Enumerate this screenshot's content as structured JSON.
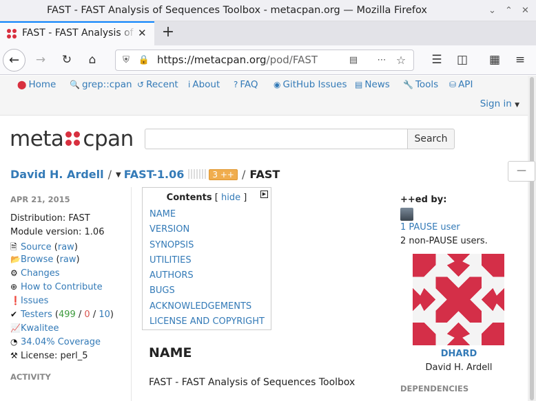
{
  "browser": {
    "window_title": "FAST - FAST Analysis of Sequences Toolbox - metacpan.org — Mozilla Firefox",
    "tab_title": "FAST - FAST Analysis of Sequences Toolbox",
    "url_host": "https://metacpan.org",
    "url_path": "/pod/FAST"
  },
  "sitenav": {
    "items": [
      {
        "label": "Home",
        "icon": "home-dots-icon"
      },
      {
        "label": "grep::cpan",
        "icon": "search-icon"
      },
      {
        "label": "Recent",
        "icon": "history-icon"
      },
      {
        "label": "About",
        "icon": "info-icon"
      },
      {
        "label": "FAQ",
        "icon": "question-icon"
      },
      {
        "label": "GitHub Issues",
        "icon": "github-icon"
      },
      {
        "label": "News",
        "icon": "news-icon"
      },
      {
        "label": "Tools",
        "icon": "wrench-icon"
      },
      {
        "label": "API",
        "icon": "database-icon"
      }
    ],
    "signin": "Sign in"
  },
  "logo": {
    "left": "meta",
    "right": "cpan"
  },
  "search": {
    "button": "Search",
    "placeholder": ""
  },
  "breadcrumb": {
    "author": "David H. Ardell",
    "release": "FAST-1.06",
    "plusplus": "3 ++",
    "module": "FAST"
  },
  "release_info": {
    "date": "APR 21, 2015",
    "distribution": "Distribution: FAST",
    "module_version": "Module version: 1.06",
    "source": "Source",
    "source_raw": "raw",
    "browse": "Browse",
    "browse_raw": "raw",
    "changes": "Changes",
    "contribute": "How to Contribute",
    "issues": "Issues",
    "testers": "Testers",
    "testers_pass": "499",
    "testers_fail": "0",
    "testers_na": "10",
    "kwalitee": "Kwalitee",
    "coverage": "34.04% Coverage",
    "license": "License: perl_5",
    "activity": "ACTIVITY"
  },
  "toc": {
    "title": "Contents",
    "hide": "hide",
    "items": [
      "NAME",
      "VERSION",
      "SYNOPSIS",
      "UTILITIES",
      "AUTHORS",
      "BUGS",
      "ACKNOWLEDGEMENTS",
      "LICENSE AND COPYRIGHT"
    ]
  },
  "content": {
    "heading": "NAME",
    "text": "FAST - FAST Analysis of Sequences Toolbox"
  },
  "sidebar": {
    "plussed_by": "++ed by:",
    "pause_users": "1 PAUSE user",
    "non_pause": "2 non-PAUSE users.",
    "author_id": "DHARD",
    "author_name": "David H. Ardell",
    "dependencies": "DEPENDENCIES"
  },
  "colors": {
    "link": "#337ab7",
    "brand_red": "#d8303f",
    "plusplus": "#f0ad4e"
  }
}
